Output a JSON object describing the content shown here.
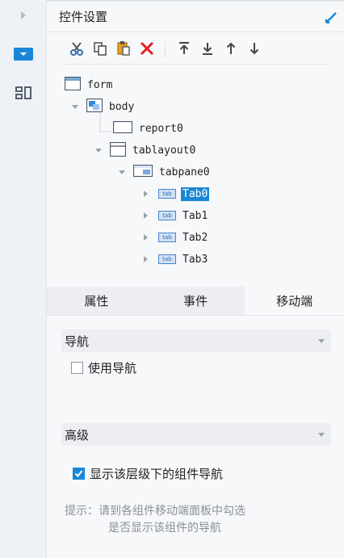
{
  "panel": {
    "title": "控件设置"
  },
  "colors": {
    "accent": "#1a87d6",
    "delete": "#e02020",
    "cut": "#3a6fb0"
  },
  "rail": {
    "items": [
      {
        "icon": "collapse-arrow-icon"
      },
      {
        "icon": "widget-settings-icon",
        "active": true
      },
      {
        "icon": "layout-icon"
      }
    ]
  },
  "toolbar": {
    "buttons": [
      {
        "icon": "cut-icon"
      },
      {
        "icon": "copy-icon"
      },
      {
        "icon": "paste-icon"
      },
      {
        "icon": "delete-icon"
      },
      {
        "icon": "move-to-top-icon"
      },
      {
        "icon": "move-to-bottom-icon"
      },
      {
        "icon": "move-up-icon"
      },
      {
        "icon": "move-down-icon"
      }
    ]
  },
  "tree": {
    "form": "form",
    "body": "body",
    "report0": "report0",
    "tablayout0": "tablayout0",
    "tabpane0": "tabpane0",
    "tab_icon_text": "tab",
    "tabs": [
      "Tab0",
      "Tab1",
      "Tab2",
      "Tab3"
    ],
    "selected": "Tab0"
  },
  "prop_tabs": [
    {
      "label": "属性"
    },
    {
      "label": "事件"
    },
    {
      "label": "移动端",
      "active": true
    }
  ],
  "sections": {
    "navigation": {
      "title": "导航",
      "checkbox_label": "使用导航",
      "checked": false
    },
    "advanced": {
      "title": "高级",
      "checkbox_label": "显示该层级下的组件导航",
      "checked": true
    }
  },
  "hint": {
    "line1": "提示：请到各组件移动端面板中勾选",
    "line2": "是否显示该组件的导航"
  }
}
